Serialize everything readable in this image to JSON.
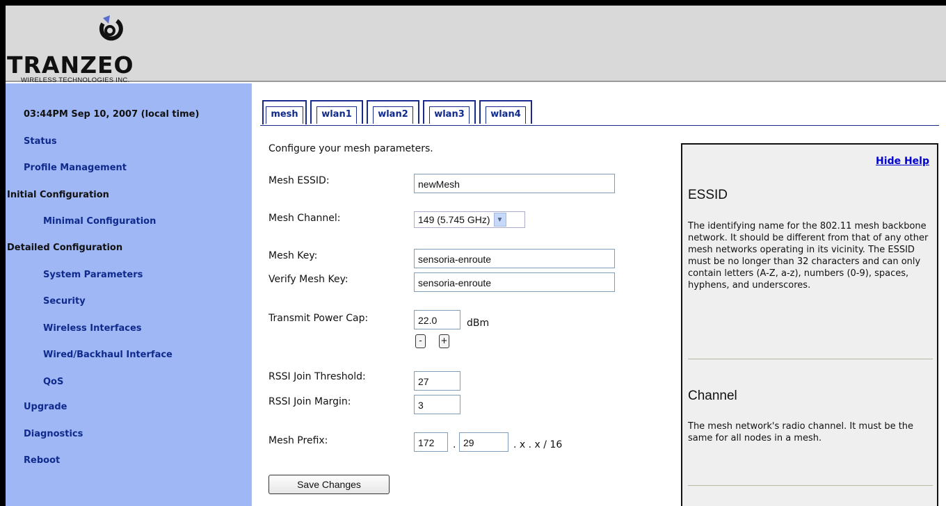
{
  "header": {
    "brand": "TRANZEO",
    "subtitle": "WIRELESS TECHNOLOGIES INC."
  },
  "sidebar": {
    "clock": "03:44PM Sep 10, 2007 (local time)",
    "items": [
      {
        "label": "Status"
      },
      {
        "label": "Profile Management"
      },
      {
        "label": "Initial Configuration"
      },
      {
        "label": "Minimal Configuration"
      },
      {
        "label": "Detailed Configuration"
      },
      {
        "label": "System Parameters"
      },
      {
        "label": "Security"
      },
      {
        "label": "Wireless Interfaces"
      },
      {
        "label": "Wired/Backhaul Interface"
      },
      {
        "label": "QoS"
      },
      {
        "label": "Upgrade"
      },
      {
        "label": "Diagnostics"
      },
      {
        "label": "Reboot"
      }
    ]
  },
  "tabs": [
    {
      "label": "mesh",
      "active": true
    },
    {
      "label": "wlan1"
    },
    {
      "label": "wlan2"
    },
    {
      "label": "wlan3"
    },
    {
      "label": "wlan4"
    }
  ],
  "form": {
    "intro": "Configure your mesh parameters.",
    "essid_label": "Mesh ESSID:",
    "essid_value": "newMesh",
    "channel_label": "Mesh Channel:",
    "channel_value": "149 (5.745 GHz)",
    "key_label": "Mesh Key:",
    "key_value": "sensoria-enroute",
    "verify_label": "Verify Mesh Key:",
    "verify_value": "sensoria-enroute",
    "power_label": "Transmit Power Cap:",
    "power_value": "22.0",
    "power_unit": "dBm",
    "minus": "-",
    "plus": "+",
    "rssi_thresh_label": "RSSI Join Threshold:",
    "rssi_thresh_value": "27",
    "rssi_margin_label": "RSSI Join Margin:",
    "rssi_margin_value": "3",
    "prefix_label": "Mesh Prefix:",
    "prefix_1": "172",
    "prefix_dot": ".",
    "prefix_2": "29",
    "prefix_suffix": ". x . x / 16",
    "save_label": "Save Changes"
  },
  "help": {
    "hide_label": "Hide Help",
    "essid_title": "ESSID",
    "essid_text": "The identifying name for the 802.11 mesh backbone network. It should be different from that of any other mesh networks operating in its vicinity. The ESSID must be no longer than 32 characters and can only contain letters (A-Z, a-z), numbers (0-9), spaces, hyphens, and underscores.",
    "channel_title": "Channel",
    "channel_text": "The mesh network's radio channel. It must be the same for all nodes in a mesh."
  },
  "colors": {
    "sidebar_bg": "#9fb8f5",
    "header_bg": "#d9d9d9",
    "link": "#0f2a8c",
    "help_link": "#0000cc"
  }
}
